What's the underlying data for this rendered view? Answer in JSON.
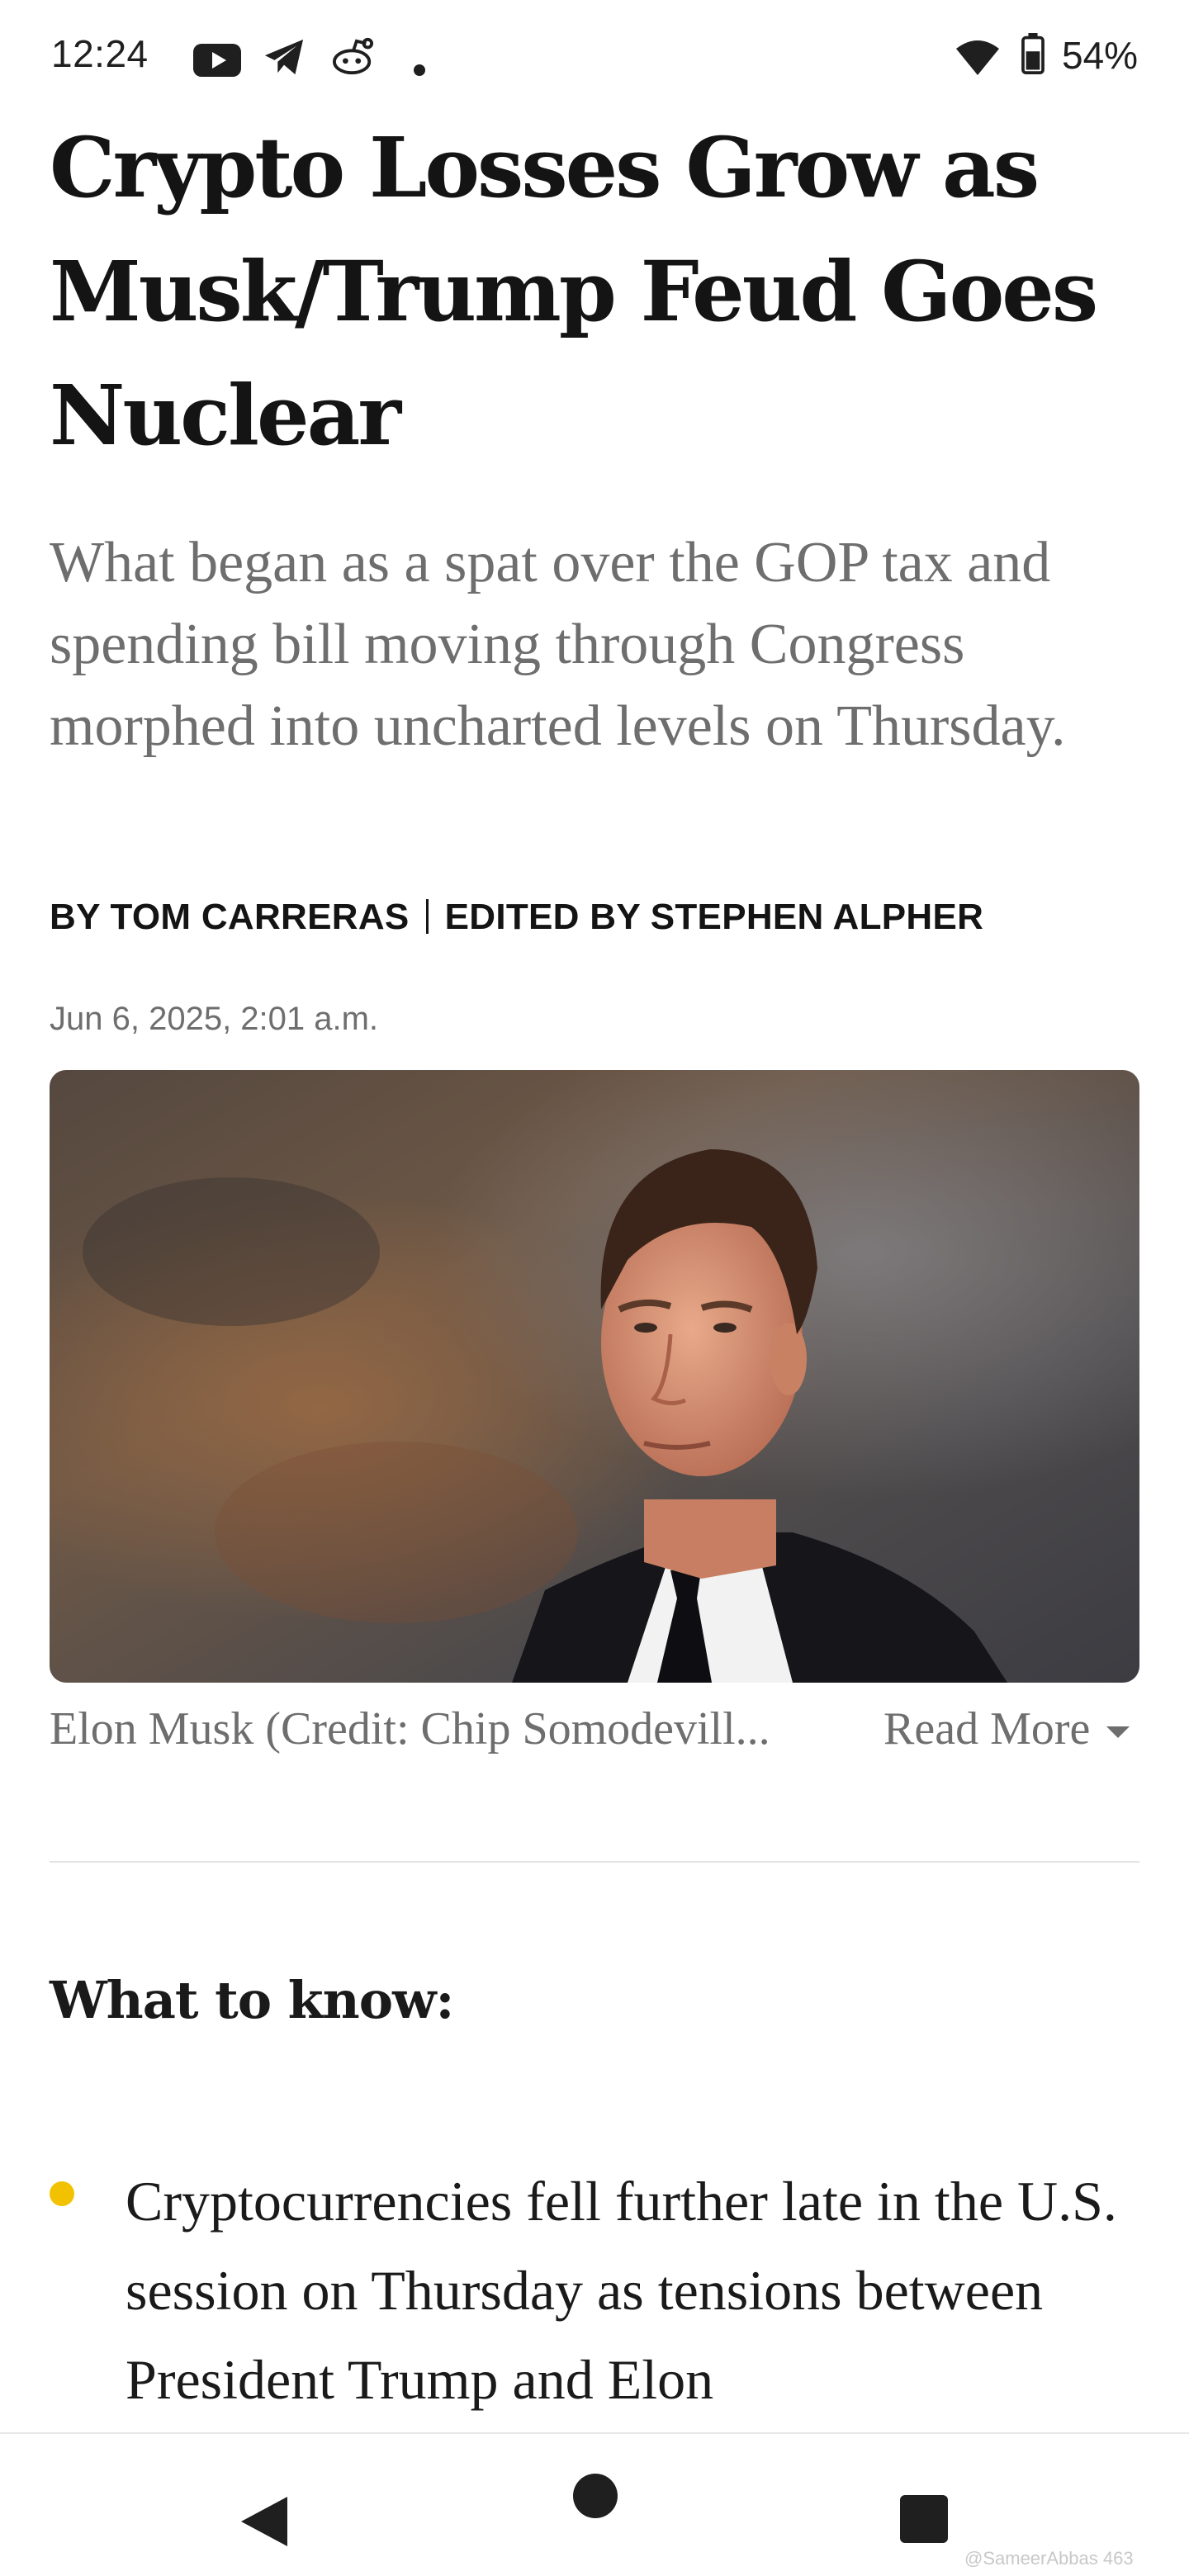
{
  "status_bar": {
    "time": "12:24",
    "battery_percent": "54%",
    "icons": [
      "youtube-icon",
      "telegram-icon",
      "reddit-icon",
      "notification-dot-icon",
      "wifi-icon",
      "battery-icon"
    ]
  },
  "article": {
    "headline": "Crypto Losses Grow as Musk/Trump Feud Goes Nuclear",
    "dek": "What began as a spat over the GOP tax and spending bill moving through Congress morphed into uncharted levels on Thursday.",
    "byline_author": "BY TOM CARRERAS",
    "byline_editor": "EDITED BY STEPHEN ALPHER",
    "date": "Jun 6, 2025, 2:01 a.m.",
    "image_caption": "Elon Musk (Credit: Chip Somodevill...",
    "read_more": "Read More",
    "section_title": "What to know:",
    "bullets": [
      "Cryptocurrencies fell further late in the U.S. session on Thursday as tensions between President Trump and Elon"
    ]
  },
  "nav_bar": {
    "watermark": "@SameerAbbas 463"
  },
  "colors": {
    "bullet_accent": "#f2c200",
    "muted_text": "#6e6e6e",
    "headline_text": "#141414"
  }
}
